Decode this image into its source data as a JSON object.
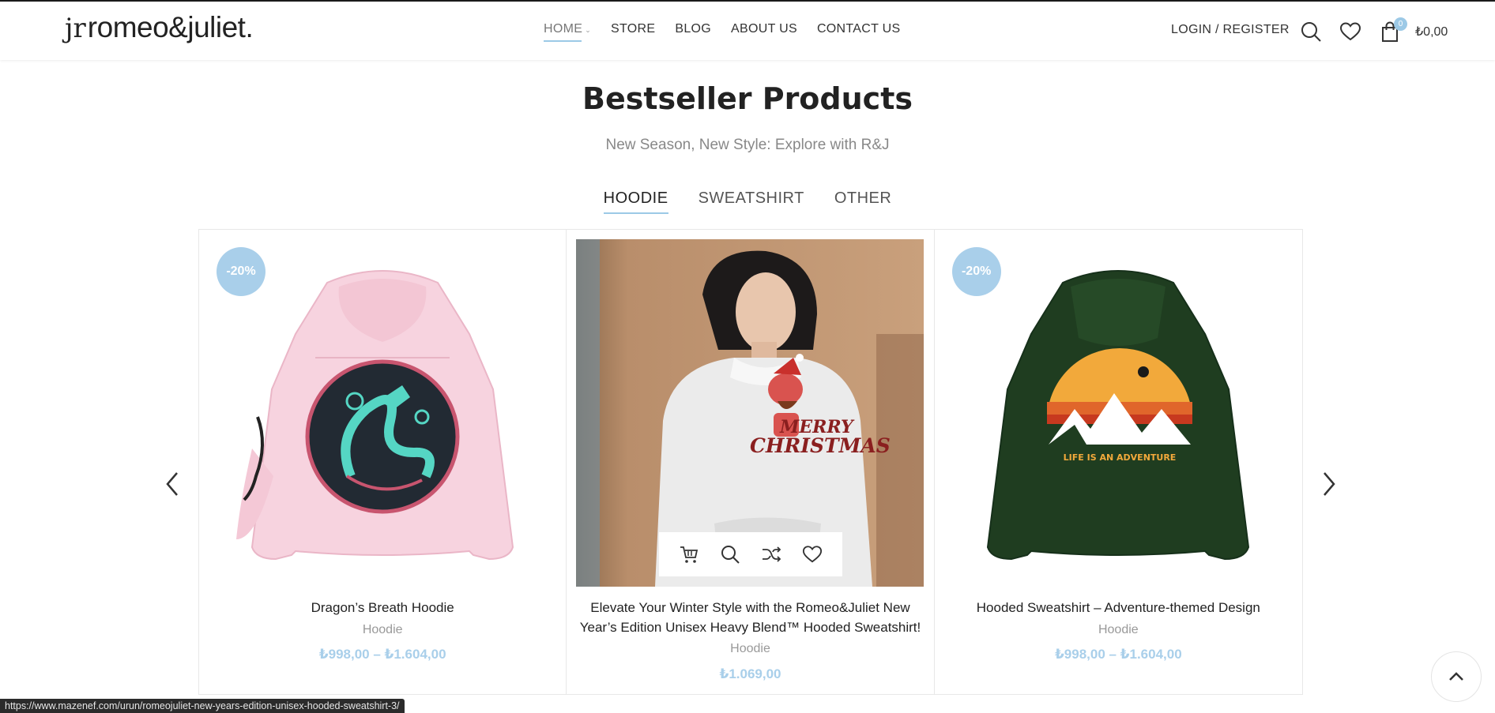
{
  "header": {
    "logo_mark": "jr",
    "logo_text": "romeo&juliet.",
    "nav": [
      {
        "label": "HOME",
        "active": true
      },
      {
        "label": "STORE",
        "active": false
      },
      {
        "label": "BLOG",
        "active": false
      },
      {
        "label": "ABOUT US",
        "active": false
      },
      {
        "label": "CONTACT US",
        "active": false
      }
    ],
    "login_label": "LOGIN / REGISTER",
    "cart_count": "0",
    "cart_total": "₺0,00",
    "icons": [
      "search-icon",
      "heart-icon",
      "cart-icon"
    ]
  },
  "section": {
    "title": "Bestseller Products",
    "subtitle": "New Season, New Style: Explore with R&J",
    "tabs": [
      {
        "label": "HOODIE",
        "active": true
      },
      {
        "label": "SWEATSHIRT",
        "active": false
      },
      {
        "label": "OTHER",
        "active": false
      }
    ]
  },
  "products": [
    {
      "badge": "-20%",
      "title": "Dragon’s Breath Hoodie",
      "category": "Hoodie",
      "price": "₺998,00 – ₺1.604,00",
      "image": "pink-dragon-hoodie"
    },
    {
      "badge": "",
      "title": "Elevate Your Winter Style with the Romeo&Juliet New Year’s Edition Unisex Heavy Blend™ Hooded Sweatshirt!",
      "category": "Hoodie",
      "price": "₺1.069,00",
      "image": "woman-white-christmas-hoodie",
      "print_text": "MERRY CHRISTMAS"
    },
    {
      "badge": "-20%",
      "title": "Hooded Sweatshirt – Adventure-themed Design",
      "category": "Hoodie",
      "price": "₺998,00 – ₺1.604,00",
      "image": "green-adventure-hoodie",
      "print_text": "LIFE IS AN ADVENTURE"
    }
  ],
  "hover_actions": [
    "add-to-cart-icon",
    "quick-view-icon",
    "compare-icon",
    "wishlist-icon"
  ],
  "status_url": "https://www.mazenef.com/urun/romeojuliet-new-years-edition-unisex-hooded-sweatshirt-3/",
  "colors": {
    "accent": "#a9cfea",
    "text_dark": "#222222",
    "muted": "#999999"
  }
}
